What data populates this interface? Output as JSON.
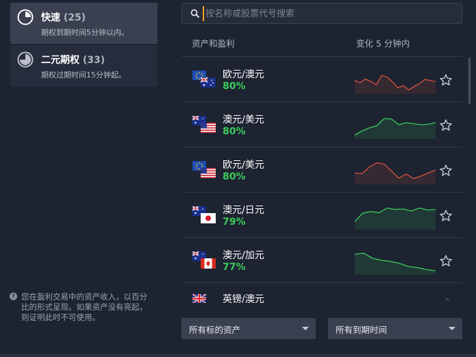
{
  "categories": [
    {
      "title": "快速",
      "count": "(25)",
      "desc": "期权到期时间5分钟以内。",
      "icon": "clock-quarter-icon",
      "active": true
    },
    {
      "title": "二元期权",
      "count": "(33)",
      "desc": "期权过期时间15分钟起。",
      "icon": "clock-three-quarter-icon",
      "active": false
    }
  ],
  "note": "您在盈利交易中的资产收入，以百分比的形式呈现。如果资产没有亮起，则证明此时不可使用。",
  "search": {
    "placeholder": "按名称或股票代号搜索"
  },
  "headers": {
    "asset": "资产和盈利",
    "change": "变化 5 分钟内"
  },
  "assets": [
    {
      "pair": "欧元/澳元",
      "profit": "80%",
      "flags": [
        "eu",
        "au"
      ],
      "trend": "down",
      "spark": [
        0.55,
        0.45,
        0.62,
        0.5,
        0.35,
        0.8,
        0.72,
        0.48,
        0.2,
        0.3,
        0.1,
        0.25,
        0.4,
        0.6,
        0.55,
        0.5
      ]
    },
    {
      "pair": "澳元/美元",
      "profit": "80%",
      "flags": [
        "au",
        "us"
      ],
      "trend": "up",
      "spark": [
        0.1,
        0.3,
        0.45,
        0.55,
        0.9,
        0.88,
        0.6,
        0.7,
        0.65,
        0.6,
        0.62,
        0.7
      ]
    },
    {
      "pair": "欧元/美元",
      "profit": "80%",
      "flags": [
        "eu",
        "us"
      ],
      "trend": "down",
      "spark": [
        0.45,
        0.42,
        0.75,
        0.95,
        0.88,
        0.55,
        0.2,
        0.4,
        0.18,
        0.3,
        0.45,
        0.6
      ]
    },
    {
      "pair": "澳元/日元",
      "profit": "79%",
      "flags": [
        "au",
        "jp"
      ],
      "trend": "up",
      "spark": [
        0.3,
        0.7,
        0.78,
        0.72,
        0.95,
        0.88,
        0.9,
        0.8,
        0.95,
        0.85,
        0.88
      ]
    },
    {
      "pair": "澳元/加元",
      "profit": "77%",
      "flags": [
        "au",
        "ca"
      ],
      "trend": "up",
      "spark": [
        0.9,
        0.95,
        0.7,
        0.6,
        0.55,
        0.45,
        0.3,
        0.25,
        0.15,
        0.1
      ]
    },
    {
      "pair": "英镑/澳元",
      "profit": "",
      "flags": [
        "uk",
        "au"
      ],
      "trend": "up",
      "spark": []
    }
  ],
  "filters": {
    "asset_filter": "所有标的资产",
    "expiry_filter": "所有到期时间"
  },
  "colors": {
    "up": "#3ccd5a",
    "down": "#d9523f",
    "accent": "#f5a623"
  }
}
